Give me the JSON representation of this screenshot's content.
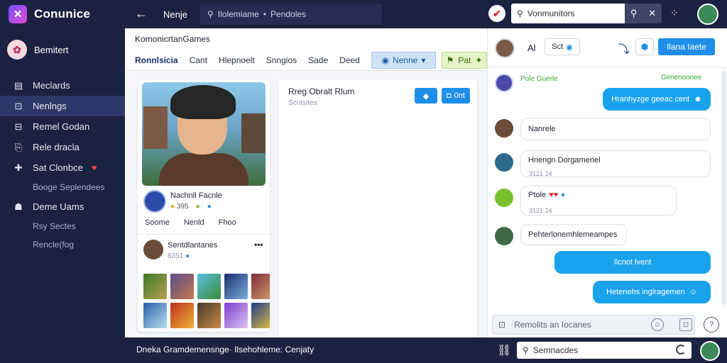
{
  "app": {
    "title": "Conunice",
    "logo_glyph": "✕"
  },
  "sidebar": {
    "profile_name": "Bemitert",
    "profile_glyph": "✿",
    "items": [
      {
        "label": "Meclards",
        "icon": "▤"
      },
      {
        "label": "Nenlngs",
        "icon": "⊡"
      },
      {
        "label": "Remel Godan",
        "icon": "⊟"
      },
      {
        "label": "Rele dracla",
        "icon": "⎘"
      },
      {
        "label": "Sat Clonbce",
        "icon": "✚"
      },
      {
        "label": "Booge Seplendees",
        "icon": ""
      },
      {
        "label": "Deme Uams",
        "icon": "☗"
      },
      {
        "label": "Rsy Sectes",
        "icon": ""
      },
      {
        "label": "Rencle(fog",
        "icon": ""
      }
    ]
  },
  "topbar": {
    "back_glyph": "←",
    "title": "Nenje",
    "search_text": "Ilolemiame",
    "search_sep": "•",
    "search_text2": "Pendoles",
    "right_search_placeholder": "Vonmunitors",
    "check_glyph": "✔",
    "grid_glyph": "⁘"
  },
  "main": {
    "heading": "KomonicrtanGames",
    "tabs": [
      "Ronnlsicia",
      "Cant",
      "Hlepnoelt",
      "Snngios",
      "Sade",
      "Deed"
    ],
    "tab_blue": "Nenne",
    "tab_green": "Pat"
  },
  "profile_card": {
    "name": "Nachnll Facnle",
    "coins": "395",
    "links": [
      "Soome",
      "Nenld",
      "Fhoo"
    ],
    "friend_name": "Sentdlantanes",
    "friend_sub": "8351",
    "more_glyph": "•••"
  },
  "post": {
    "title": "Rreg Obralt Rlum",
    "subtitle": "Scntsites",
    "btn1_glyph": "◆",
    "btn2_label": "0nt"
  },
  "chat": {
    "header_letter": "Al",
    "header_pill": "Sct",
    "header_btn": "Ilana Iaete",
    "messages": {
      "m1_name": "Pole Guerle",
      "m1_right": "Gimenoonee",
      "m2": "Hranhyzge geeac cent",
      "m3": "Nanrele",
      "m4": "Hnengn Dorgamenel",
      "m4_ts": "3121 24",
      "m5": "Ptole",
      "m5_ts": "3121 24",
      "m6": "Pehterlonemhlemeampes",
      "m7": "Ilcnot lvent",
      "m8": "Hetenehs inglragemen"
    },
    "input_placeholder": "Remolits an Iocanes",
    "send_glyph": "?"
  },
  "bottombar": {
    "text": "Dneka Gramdemensnge· Ilsehohleme: Cenjaty",
    "search_placeholder": "Semnacdes",
    "link_glyph": "⛓"
  },
  "colors": {
    "navy": "#1b2140",
    "accent_blue": "#1f8ee9",
    "bubble_out": "#1aa2ec"
  }
}
